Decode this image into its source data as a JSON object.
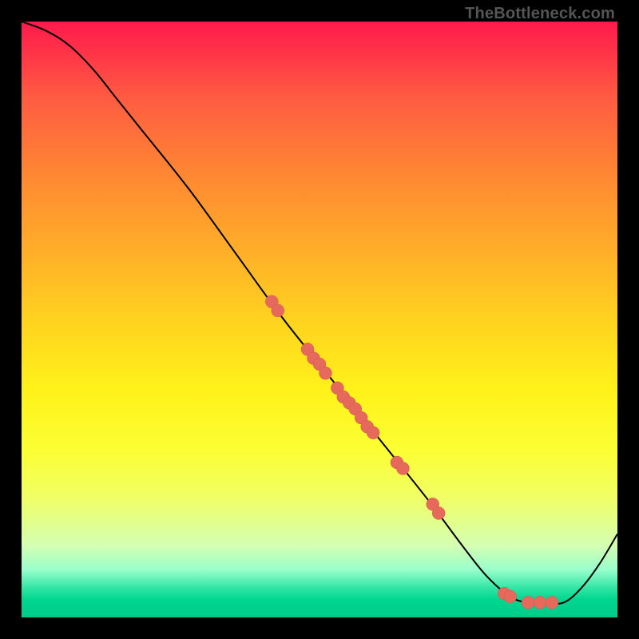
{
  "watermark": "TheBottleneck.com",
  "chart_data": {
    "type": "line",
    "title": "",
    "xlabel": "",
    "ylabel": "",
    "xlim": [
      0,
      100
    ],
    "ylim": [
      0,
      100
    ],
    "curve": [
      {
        "x": 0,
        "y": 100
      },
      {
        "x": 4,
        "y": 98.5
      },
      {
        "x": 8,
        "y": 96
      },
      {
        "x": 12,
        "y": 92
      },
      {
        "x": 16,
        "y": 87
      },
      {
        "x": 20,
        "y": 82
      },
      {
        "x": 28,
        "y": 72
      },
      {
        "x": 36,
        "y": 61
      },
      {
        "x": 44,
        "y": 50
      },
      {
        "x": 52,
        "y": 40
      },
      {
        "x": 60,
        "y": 30
      },
      {
        "x": 68,
        "y": 20
      },
      {
        "x": 74,
        "y": 12
      },
      {
        "x": 78,
        "y": 7
      },
      {
        "x": 82,
        "y": 3.5
      },
      {
        "x": 85,
        "y": 2.5
      },
      {
        "x": 88,
        "y": 2.5
      },
      {
        "x": 91,
        "y": 2.5
      },
      {
        "x": 94,
        "y": 5
      },
      {
        "x": 97,
        "y": 9
      },
      {
        "x": 100,
        "y": 14
      }
    ],
    "points": [
      {
        "x": 42,
        "y": 53
      },
      {
        "x": 43,
        "y": 51.5
      },
      {
        "x": 48,
        "y": 45
      },
      {
        "x": 49,
        "y": 43.5
      },
      {
        "x": 50,
        "y": 42.5
      },
      {
        "x": 51,
        "y": 41
      },
      {
        "x": 53,
        "y": 38.5
      },
      {
        "x": 54,
        "y": 37
      },
      {
        "x": 55,
        "y": 36
      },
      {
        "x": 56,
        "y": 35
      },
      {
        "x": 57,
        "y": 33.5
      },
      {
        "x": 58,
        "y": 32
      },
      {
        "x": 59,
        "y": 31
      },
      {
        "x": 63,
        "y": 26
      },
      {
        "x": 64,
        "y": 25
      },
      {
        "x": 69,
        "y": 19
      },
      {
        "x": 70,
        "y": 17.5
      },
      {
        "x": 81,
        "y": 4
      },
      {
        "x": 82,
        "y": 3.5
      },
      {
        "x": 85,
        "y": 2.5
      },
      {
        "x": 87,
        "y": 2.5
      },
      {
        "x": 89,
        "y": 2.5
      }
    ],
    "point_radius_px": 8
  }
}
